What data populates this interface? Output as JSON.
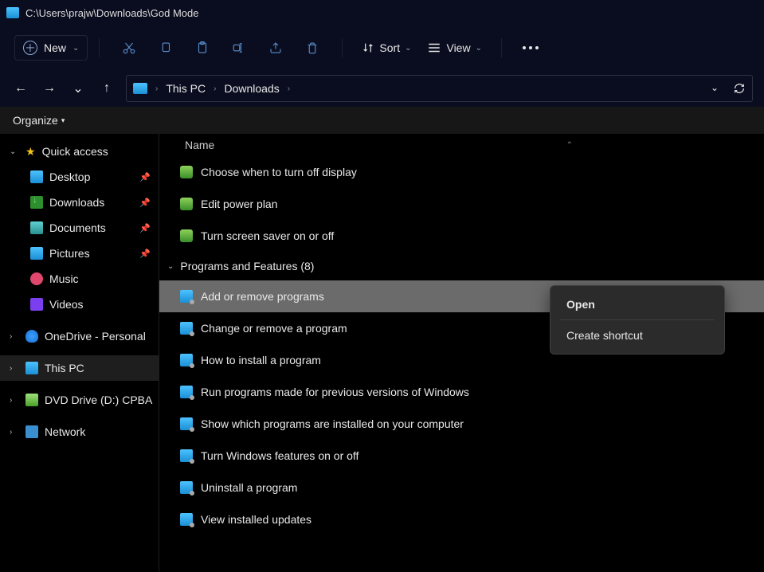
{
  "title_path": "C:\\Users\\prajw\\Downloads\\God Mode",
  "toolbar": {
    "new_label": "New",
    "sort_label": "Sort",
    "view_label": "View"
  },
  "breadcrumb": {
    "root": "This PC",
    "items": [
      "Downloads"
    ]
  },
  "organize_label": "Organize",
  "sidebar": {
    "quick_access": "Quick access",
    "desktop": "Desktop",
    "downloads": "Downloads",
    "documents": "Documents",
    "pictures": "Pictures",
    "music": "Music",
    "videos": "Videos",
    "onedrive": "OneDrive - Personal",
    "this_pc": "This PC",
    "dvd": "DVD Drive (D:) CPBA",
    "network": "Network"
  },
  "columns": {
    "name": "Name"
  },
  "groups": {
    "programs_features": "Programs and Features (8)"
  },
  "items": {
    "turn_off_display": "Choose when to turn off display",
    "edit_power": "Edit power plan",
    "screen_saver": "Turn screen saver on or off",
    "add_remove": "Add or remove programs",
    "change_remove": "Change or remove a program",
    "how_install": "How to install a program",
    "run_prev": "Run programs made for previous versions of Windows",
    "show_installed": "Show which programs are installed on your computer",
    "win_features": "Turn Windows features on or off",
    "uninstall": "Uninstall a program",
    "view_updates": "View installed updates"
  },
  "context_menu": {
    "open": "Open",
    "create_shortcut": "Create shortcut"
  }
}
